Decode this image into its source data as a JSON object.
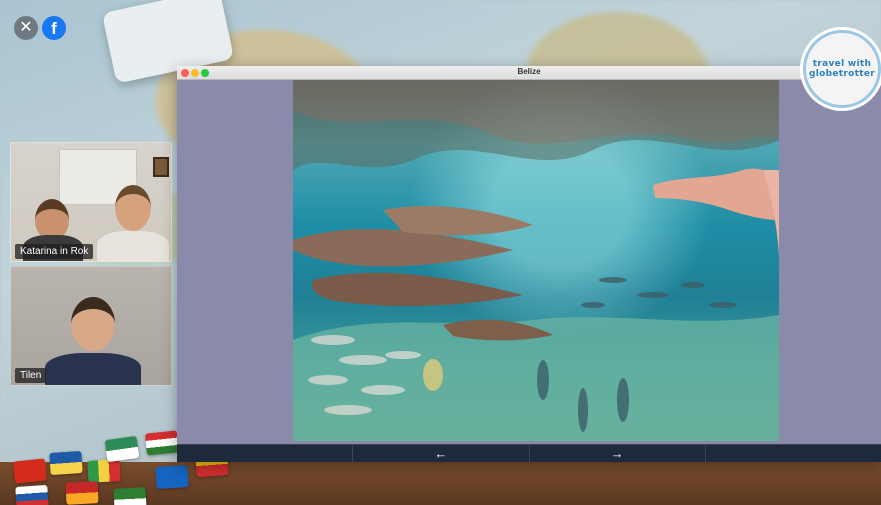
{
  "controls": {
    "close_icon": "✕",
    "facebook_icon": "f"
  },
  "participants": [
    {
      "name": "Katarina in Rok"
    },
    {
      "name": "Tilen"
    }
  ],
  "window": {
    "title": "Belize",
    "prev_arrow": "←",
    "next_arrow": "→"
  },
  "logo": {
    "line1": "travel with",
    "line2": "globetrotter"
  },
  "colors": {
    "window_bg": "#8a8aaa",
    "nav_bar": "#1e2a3c",
    "facebook": "#1877f2",
    "logo_text": "#2e7fbf"
  }
}
